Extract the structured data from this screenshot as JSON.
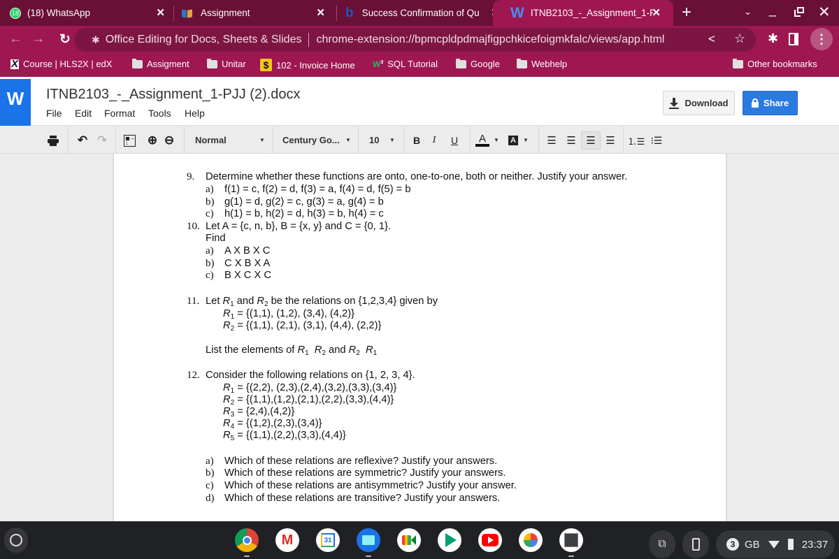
{
  "browser": {
    "tabs": [
      {
        "title": "(18) WhatsApp",
        "badge": "18",
        "icon": "whatsapp-icon",
        "active": false
      },
      {
        "title": "Assignment",
        "icon": "book-icon",
        "active": false
      },
      {
        "title": "Success Confirmation of Qu",
        "icon": "bartleby-b-icon",
        "active": false
      },
      {
        "title": "ITNB2103_-_Assignment_1-P",
        "icon": "word-w-icon",
        "active": true
      }
    ],
    "new_tab_label": "+",
    "url_site_label": "Office Editing for Docs, Sheets & Slides",
    "url": "chrome-extension://bpmcpldpdmajfigpchkicefoigmkfalc/views/app.html",
    "bookmarks": [
      {
        "label": "Course | HLS2X | edX",
        "icon": "edx-x-icon"
      },
      {
        "label": "Assigment",
        "icon": "folder-icon"
      },
      {
        "label": "Unitar",
        "icon": "folder-icon"
      },
      {
        "label": "102 - Invoice Home",
        "icon": "dollar-icon"
      },
      {
        "label": "SQL Tutorial",
        "icon": "w3schools-icon"
      },
      {
        "label": "Google",
        "icon": "folder-icon"
      },
      {
        "label": "Webhelp",
        "icon": "folder-icon"
      }
    ],
    "other_bookmarks": "Other bookmarks"
  },
  "app": {
    "logo": "W",
    "doc_title": "ITNB2103_-_Assignment_1-PJJ (2).docx",
    "menu": [
      "File",
      "Edit",
      "Format",
      "Tools",
      "Help"
    ],
    "download_label": "Download",
    "share_label": "Share",
    "toolbar": {
      "style": "Normal",
      "font": "Century Go...",
      "size": "10",
      "bold": "B",
      "italic": "I",
      "underline": "U",
      "font_color_glyph": "A",
      "highlight_glyph": "A"
    }
  },
  "document": {
    "q9": {
      "num": "9.",
      "text": "Determine whether these functions are onto, one-to-one, both or neither. Justify your answer.",
      "items": [
        {
          "label": "a)",
          "text": "f(1) = c, f(2) = d, f(3) = a,  f(4) = d, f(5) = b"
        },
        {
          "label": "b)",
          "text": "g(1) = d, g(2) = c, g(3) = a,  g(4) = b"
        },
        {
          "label": "c)",
          "text": "h(1) = b, h(2) = d, h(3) = b,  h(4) = c"
        }
      ]
    },
    "q10": {
      "num": "10.",
      "text": "Let A = {c, n, b}, B = {x, y} and C = {0, 1}.",
      "find": "Find",
      "items": [
        {
          "label": "a)",
          "text": "A X B X C"
        },
        {
          "label": "b)",
          "text": "C X B X A"
        },
        {
          "label": "c)",
          "text": "B X C X C"
        }
      ]
    },
    "q11": {
      "num": "11.",
      "pre": "Let ",
      "mid": " and ",
      "post": " be the relations on {1,2,3,4} given by",
      "r1": "= {(1,1), (1,2), (3,4), (4,2)}",
      "r2": "= {(1,1), (2,1), (3,1), (4,4), (2,2)}",
      "list_pre": "List the elements of ",
      "list_and": " and "
    },
    "q12": {
      "num": "12.",
      "text": "Consider the following relations on {1, 2, 3, 4}.",
      "relations": [
        {
          "sub": "1",
          "text": "= {(2,2), (2,3),(2,4),(3,2),(3,3),(3,4)}"
        },
        {
          "sub": "2",
          "text": "= {(1,1),(1,2),(2,1),(2,2),(3,3),(4,4)}"
        },
        {
          "sub": "3",
          "text": "= {2,4),(4,2)}"
        },
        {
          "sub": "4",
          "text": "= {(1,2),(2,3),(3,4)}"
        },
        {
          "sub": "5",
          "text": "= {(1,1),(2,2),(3,3),(4,4)}"
        }
      ],
      "items": [
        {
          "label": "a)",
          "text": "Which of these relations are reflexive? Justify your answers."
        },
        {
          "label": "b)",
          "text": "Which of these relations are symmetric? Justify your answers."
        },
        {
          "label": "c)",
          "text": "Which of these relations are antisymmetric? Justify your answer."
        },
        {
          "label": "d)",
          "text": "Which of these relations are transitive? Justify your answers."
        }
      ]
    },
    "rel_letter": "R",
    "sub1": "1",
    "sub2": "2"
  },
  "shelf": {
    "apps": [
      "Chrome",
      "Gmail",
      "Calendar",
      "Files",
      "Meet",
      "Play Store",
      "YouTube",
      "Photos",
      "System Monitor"
    ],
    "calendar_day": "31",
    "notification_count": "3",
    "storage_label": "GB",
    "time": "23:37"
  },
  "colors": {
    "tabstrip": "#6a0f35",
    "toolbar": "#9e1750",
    "word_blue": "#1a73e8",
    "share_blue": "#2a7ae2"
  }
}
